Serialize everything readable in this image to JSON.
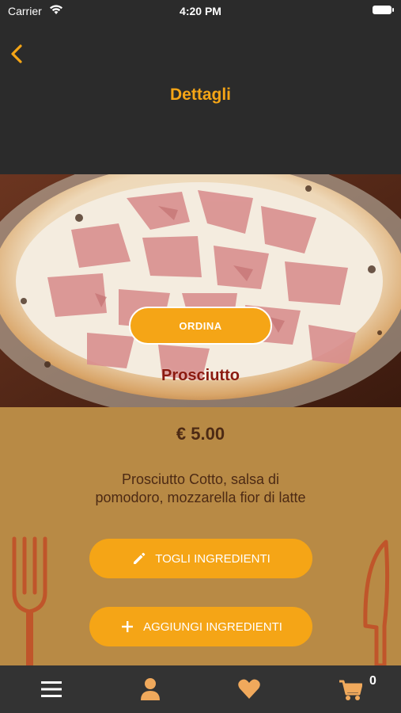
{
  "status_bar": {
    "carrier": "Carrier",
    "time": "4:20 PM"
  },
  "header": {
    "title": "Dettagli"
  },
  "product": {
    "order_label": "ORDINA",
    "name": "Prosciutto",
    "price": "€ 5.00",
    "description": "Prosciutto Cotto, salsa di pomodoro, mozzarella fior di latte"
  },
  "actions": {
    "remove_label": "TOGLI INGREDIENTI",
    "add_label": "AGGIUNGI INGREDIENTI"
  },
  "tab_bar": {
    "cart_count": "0"
  },
  "colors": {
    "accent": "#f5a516",
    "header_bg": "#2b2b2b",
    "content_bg": "#b88a45",
    "text_dark": "#4d2a14",
    "product_name": "#8b1a10",
    "tab_icon": "#f0a95c"
  },
  "icons": [
    "back-chevron-icon",
    "wifi-icon",
    "battery-icon",
    "pencil-icon",
    "plus-icon",
    "menu-icon",
    "user-icon",
    "heart-icon",
    "cart-icon",
    "fork-icon",
    "knife-icon"
  ]
}
